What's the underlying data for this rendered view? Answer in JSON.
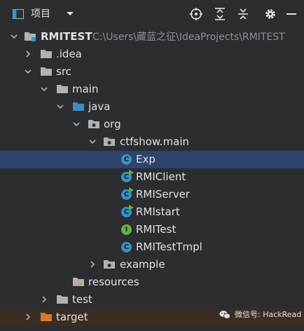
{
  "header": {
    "title": "项目",
    "icons": [
      "project-view-icon",
      "dropdown-icon",
      "locate-icon",
      "expand-all-icon",
      "collapse-all-icon",
      "settings-icon",
      "hide-icon"
    ]
  },
  "tree": {
    "root": {
      "name": "RMITEST",
      "path": "C:\\Users\\藏蓝之征\\IdeaProjects\\RMITEST"
    },
    "idea": ".idea",
    "src": "src",
    "main": "main",
    "java": "java",
    "org": "org",
    "ctfshow": "ctfshow.main",
    "files": [
      {
        "name": "Exp",
        "kind": "class",
        "runnable": false
      },
      {
        "name": "RMIClient",
        "kind": "class",
        "runnable": true
      },
      {
        "name": "RMIServer",
        "kind": "class",
        "runnable": true
      },
      {
        "name": "RMIstart",
        "kind": "class",
        "runnable": true
      },
      {
        "name": "RMITest",
        "kind": "interface",
        "runnable": false
      },
      {
        "name": "RMITestTmpl",
        "kind": "class",
        "runnable": false
      }
    ],
    "example": "example",
    "resources": "resources",
    "test": "test",
    "target": "target"
  },
  "watermark": {
    "text": "微信号: HackRead"
  },
  "colors": {
    "background": "#2b2d30",
    "selection": "#2e436e",
    "excluded": "#3b2d21",
    "folder": "#afb1b3",
    "source_folder": "#3d8ec4",
    "excluded_folder": "#d9782d",
    "class_icon": "#3592c4",
    "interface_icon": "#62b543"
  }
}
